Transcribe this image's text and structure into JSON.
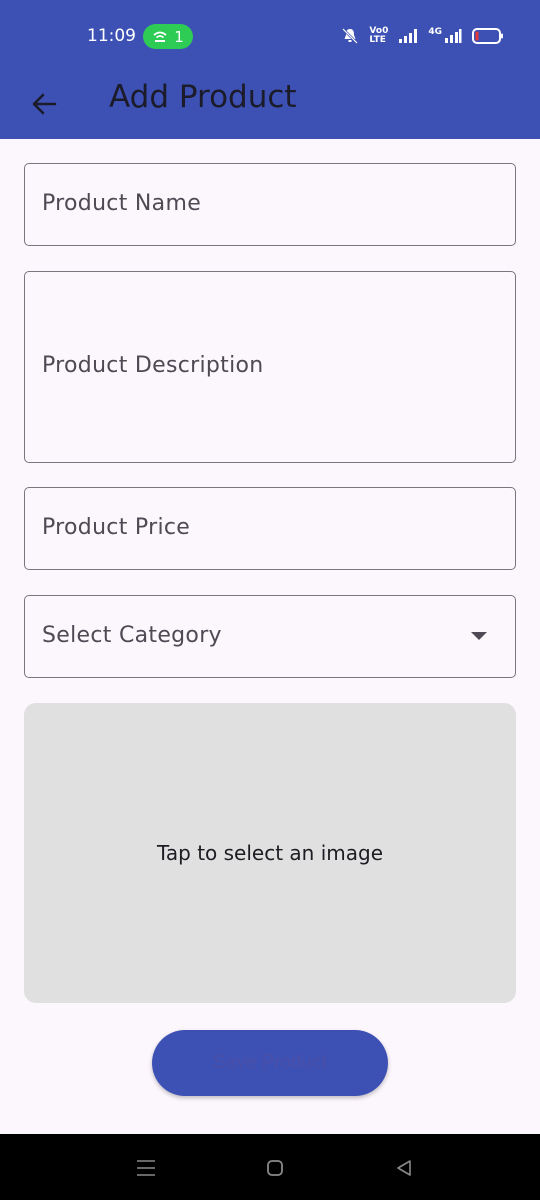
{
  "status": {
    "time": "11:09",
    "hotspot_count": "1",
    "volte": "Vo0",
    "lte": "LTE",
    "network": "4G"
  },
  "appbar": {
    "title": "Add Product"
  },
  "form": {
    "name_label": "Product Name",
    "description_label": "Product Description",
    "price_label": "Product Price",
    "category_label": "Select Category",
    "image_hint": "Tap to select an image",
    "save_label": "Save Product"
  },
  "colors": {
    "primary": "#3d51b5",
    "background": "#fcf7fd",
    "image_box": "#e0e0e0"
  }
}
